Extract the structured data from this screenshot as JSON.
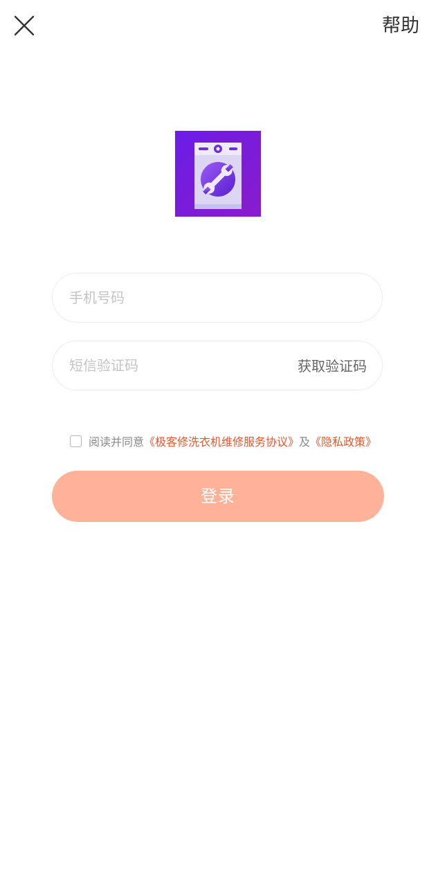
{
  "header": {
    "help_label": "帮助"
  },
  "form": {
    "phone_placeholder": "手机号码",
    "sms_placeholder": "短信验证码",
    "get_code_label": "获取验证码"
  },
  "agreement": {
    "prefix": "阅读并同意",
    "service_link": "《极客修洗衣机维修服务协议》",
    "conjunction": "及",
    "privacy_link": "《隐私政策》",
    "checked": false
  },
  "login_label": "登录",
  "colors": {
    "accent": "#e3572e",
    "button": "#ffb29a",
    "logo_bg": "#7a1ed8"
  },
  "icons": {
    "close": "close-icon",
    "logo": "washing-machine-wrench-logo"
  }
}
